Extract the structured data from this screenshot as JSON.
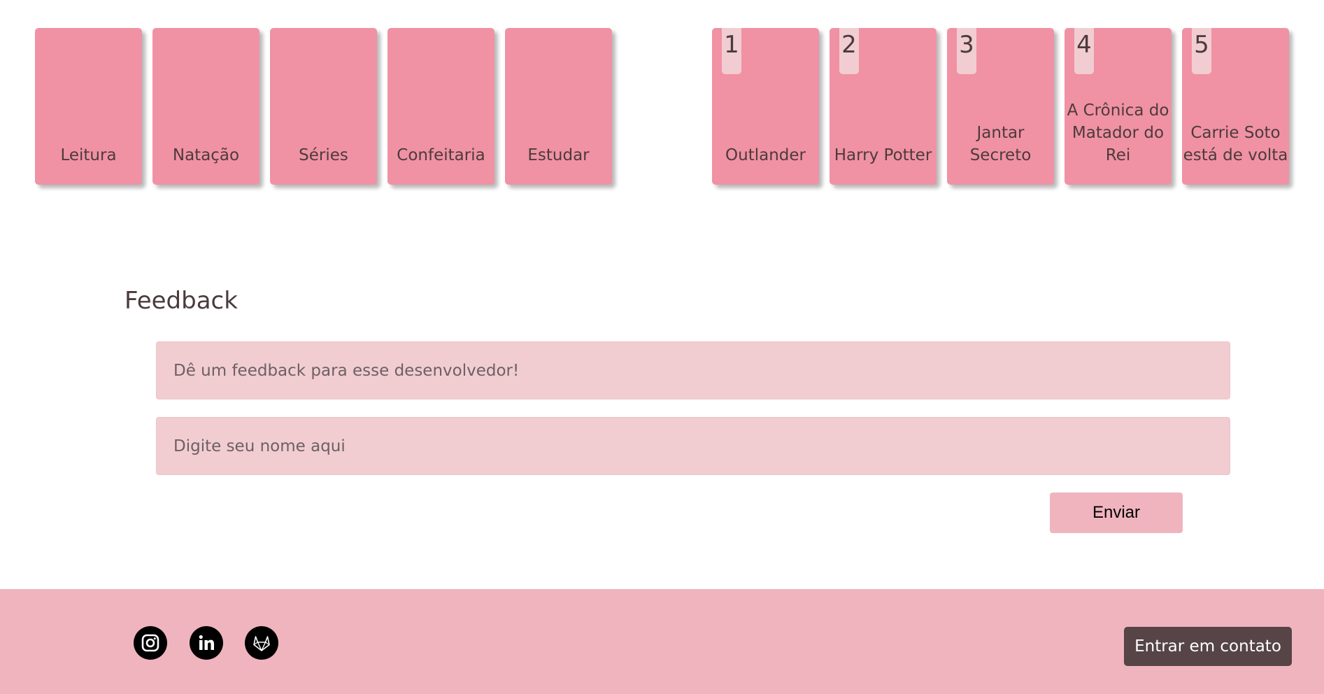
{
  "hobbies": [
    {
      "label": "Leitura"
    },
    {
      "label": "Natação"
    },
    {
      "label": "Séries"
    },
    {
      "label": "Confeitaria"
    },
    {
      "label": "Estudar"
    }
  ],
  "books": [
    {
      "rank": "1",
      "title": "Outlander"
    },
    {
      "rank": "2",
      "title": "Harry Potter"
    },
    {
      "rank": "3",
      "title": "Jantar Secreto"
    },
    {
      "rank": "4",
      "title": "A Crônica do Matador do Rei"
    },
    {
      "rank": "5",
      "title": "Carrie Soto está de volta"
    }
  ],
  "feedback": {
    "title": "Feedback",
    "feedback_placeholder": "Dê um feedback para esse desenvolvedor!",
    "name_placeholder": "Digite seu nome aqui",
    "submit_label": "Enviar"
  },
  "footer": {
    "social_icons": [
      "instagram-icon",
      "linkedin-icon",
      "gitlab-icon"
    ],
    "contact_label": "Entrar em contato"
  },
  "colors": {
    "card": "#f092a3",
    "badge": "#f1cdd2",
    "input": "#f1cdd2",
    "footer": "#f0b4bf",
    "contact_button": "#564447"
  }
}
